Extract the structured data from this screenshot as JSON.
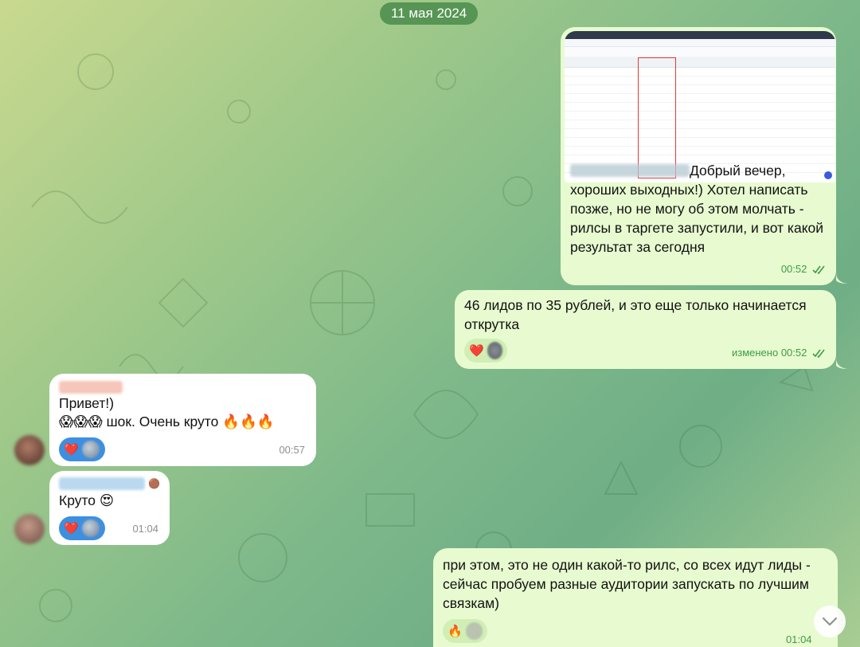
{
  "date_separator": "11 мая 2024",
  "messages": [
    {
      "direction": "out",
      "has_image": true,
      "text": "Добрый вечер, хороших выходных!) Хотел написать позже, но не могу об этом молчать - рилсы в таргете запустили, и вот какой результат за сегодня",
      "time": "00:52",
      "read": true
    },
    {
      "direction": "out",
      "text": "46 лидов по 35 рублей, и это еще только начинается открутка",
      "reactions": [
        "❤️"
      ],
      "edited_label": "изменено",
      "time": "00:52",
      "read": true
    },
    {
      "direction": "in",
      "line1": "Привет!)",
      "line2_emoji": "😱😱😱",
      "line2_text": "шок. Очень круто",
      "line2_suffix": "🔥🔥🔥",
      "reactions": [
        "❤️"
      ],
      "time": "00:57"
    },
    {
      "direction": "in",
      "name_emoji": "🟤",
      "text": "Круто",
      "text_emoji": "😍",
      "reactions": [
        "❤️"
      ],
      "time": "01:04"
    },
    {
      "direction": "out",
      "text": "при этом, это не один какой-то рилс, со всех идут лиды - сейчас пробуем разные аудитории запускать по лучшим связкам)",
      "reactions": [
        "🔥"
      ],
      "time": "01:04",
      "read": true
    }
  ],
  "colors": {
    "outgoing_bubble": "#e8fbd0",
    "incoming_bubble": "#ffffff",
    "time_out": "#3d9b45",
    "date_pill": "#4a8c4a",
    "reaction_in": "#3d8fe0"
  },
  "icons": [
    "double-check-icon",
    "chevron-down-icon",
    "avatar-icon"
  ]
}
